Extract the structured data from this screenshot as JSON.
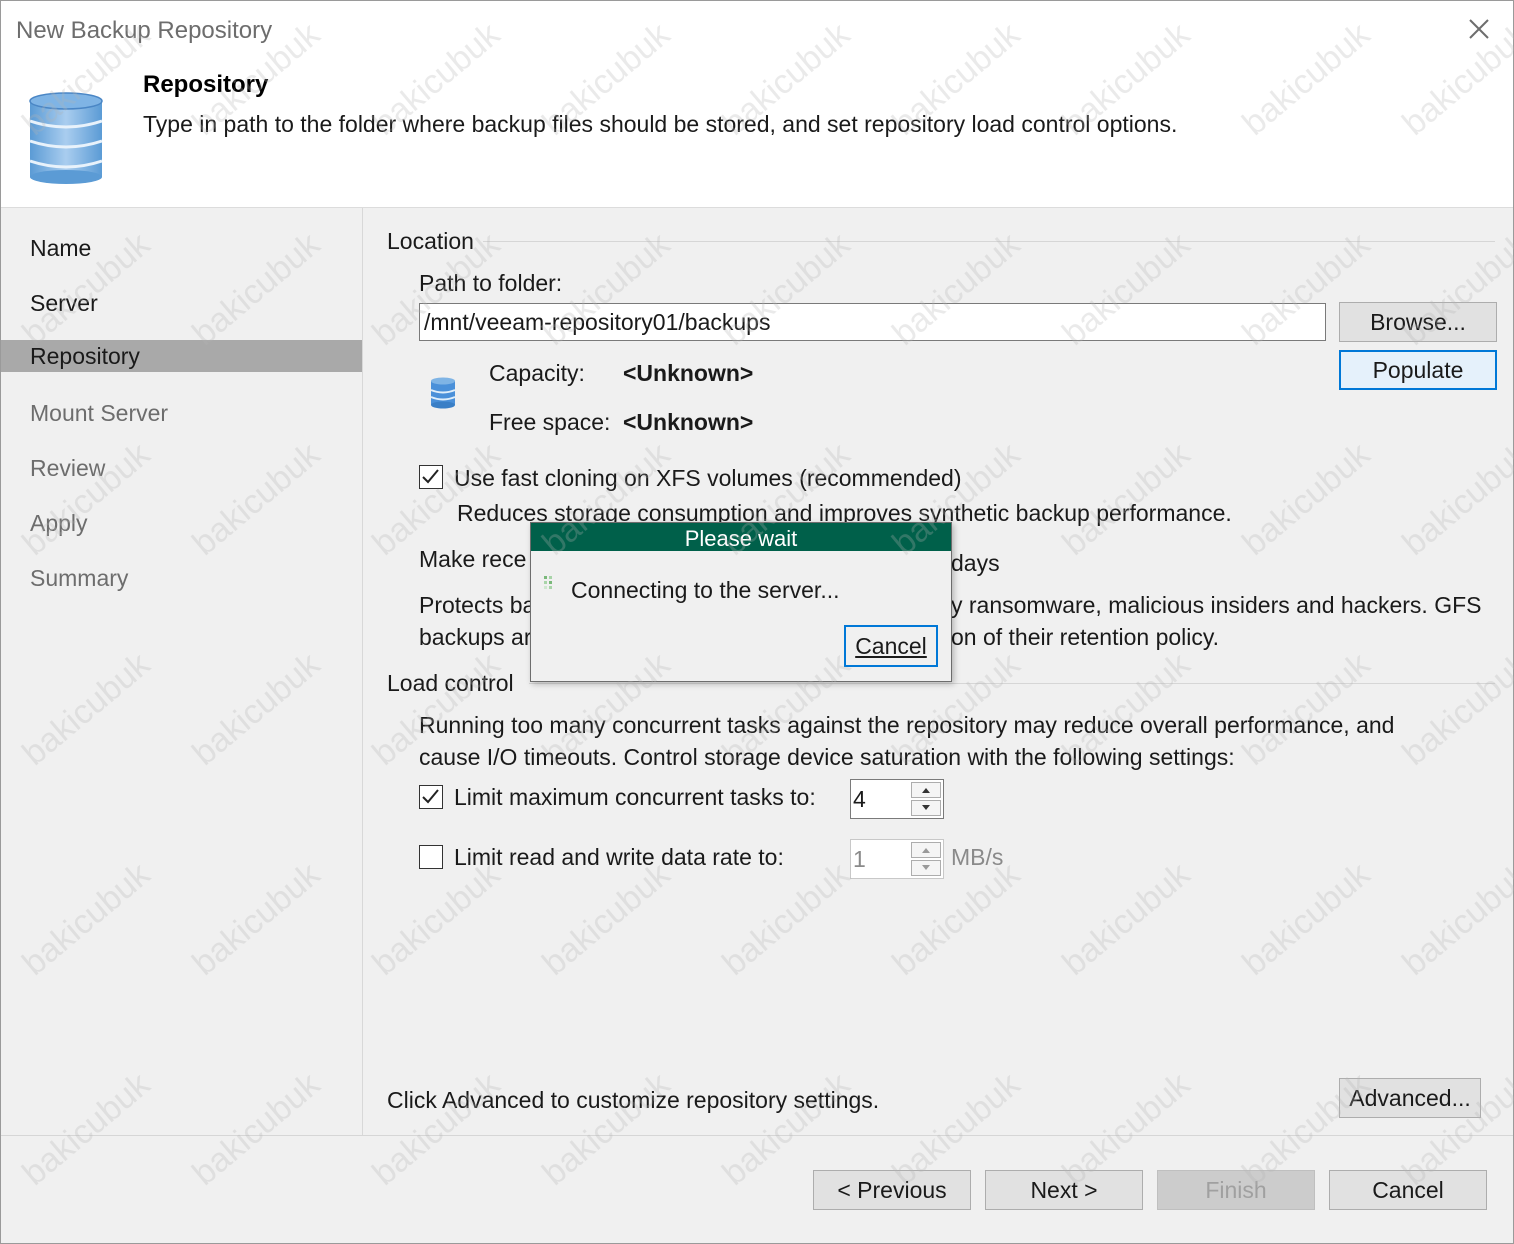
{
  "window": {
    "title": "New Backup Repository"
  },
  "header": {
    "title": "Repository",
    "description": "Type in path to the folder where backup files should be stored, and set repository load control options."
  },
  "sidebar": {
    "items": [
      {
        "label": "Name",
        "state": "done"
      },
      {
        "label": "Server",
        "state": "done"
      },
      {
        "label": "Repository",
        "state": "active"
      },
      {
        "label": "Mount Server",
        "state": "pending"
      },
      {
        "label": "Review",
        "state": "pending"
      },
      {
        "label": "Apply",
        "state": "pending"
      },
      {
        "label": "Summary",
        "state": "pending"
      }
    ]
  },
  "location": {
    "section_label": "Location",
    "path_label": "Path to folder:",
    "path_value": "/mnt/veeam-repository01/backups",
    "browse_label": "Browse...",
    "populate_label": "Populate",
    "capacity_label": "Capacity:",
    "capacity_value": "<Unknown>",
    "free_space_label": "Free space:",
    "free_space_value": "<Unknown>",
    "fast_clone_label": "Use fast cloning on XFS volumes (recommended)",
    "fast_clone_checked": true,
    "fast_clone_desc": "Reduces storage consumption and improves synthetic backup performance.",
    "immutable_label_visible": "Make rece",
    "immutable_days_suffix": "days",
    "protects_line1_left": "Protects ba",
    "protects_line1_right": "y ransomware, malicious insiders and hackers. GFS",
    "protects_line2_left": "backups ar",
    "protects_line2_right": "on of their retention policy."
  },
  "load_control": {
    "section_label": "Load control",
    "desc_line1": "Running too many concurrent tasks against the repository may reduce overall performance, and",
    "desc_line2": "cause I/O timeouts. Control storage device saturation with the following settings:",
    "limit_tasks_label": "Limit maximum concurrent tasks to:",
    "limit_tasks_checked": true,
    "limit_tasks_value": "4",
    "limit_rate_label": "Limit read and write data rate to:",
    "limit_rate_checked": false,
    "limit_rate_value": "1",
    "limit_rate_unit": "MB/s"
  },
  "advanced": {
    "hint": "Click Advanced to customize repository settings.",
    "button_label": "Advanced..."
  },
  "footer": {
    "previous_label": "< Previous",
    "next_label": "Next >",
    "finish_label": "Finish",
    "cancel_label": "Cancel"
  },
  "wait_dialog": {
    "title": "Please wait",
    "message": "Connecting to the server...",
    "cancel_label": "Cancel"
  },
  "watermark": {
    "text": "bakicubuk"
  },
  "colors": {
    "dialog_title_bg": "#00604a",
    "active_nav_bg": "#a9a9a9",
    "focus_border": "#0078d7",
    "db_icon_blue": "#4a90d9"
  }
}
